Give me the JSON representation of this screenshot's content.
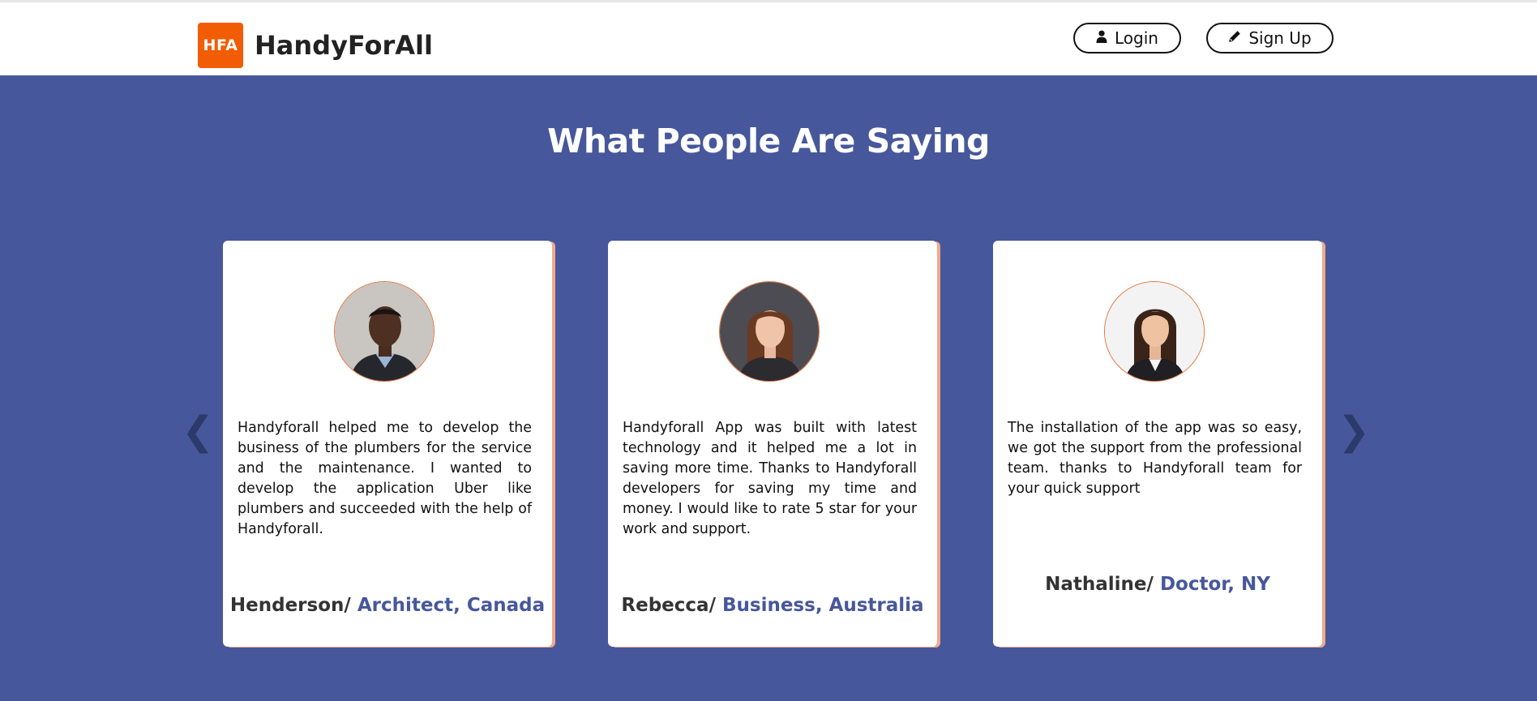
{
  "header": {
    "logo_badge": "HFA",
    "brand": "HandyForAll",
    "login_label": "Login",
    "login_icon": "user-icon",
    "signup_label": "Sign Up",
    "signup_icon": "pencil-icon"
  },
  "section": {
    "title": "What People Are Saying",
    "prev_arrow": "❮",
    "next_arrow": "❯"
  },
  "testimonials": [
    {
      "quote": "Handyforall helped me to develop the business of the plumbers for the service and the maintenance. I wanted to develop the application Uber like plumbers and succeeded with the help of Handyforall.",
      "name": "Henderson/",
      "role": "Architect, Canada"
    },
    {
      "quote": "Handyforall App was built with latest technology and it helped me a lot in saving more time. Thanks to Handyforall developers for saving my time and money. I would like to rate 5 star for your work and support.",
      "name": "Rebecca/",
      "role": "Business, Australia"
    },
    {
      "quote": "The installation of the app was so easy, we got the support from the professional team. thanks to Handyforall team for your quick support",
      "name": "Nathaline/",
      "role": "Doctor, NY"
    }
  ],
  "colors": {
    "brand_orange": "#f25c05",
    "section_blue": "#47579b",
    "card_accent": "#f2a98a"
  }
}
